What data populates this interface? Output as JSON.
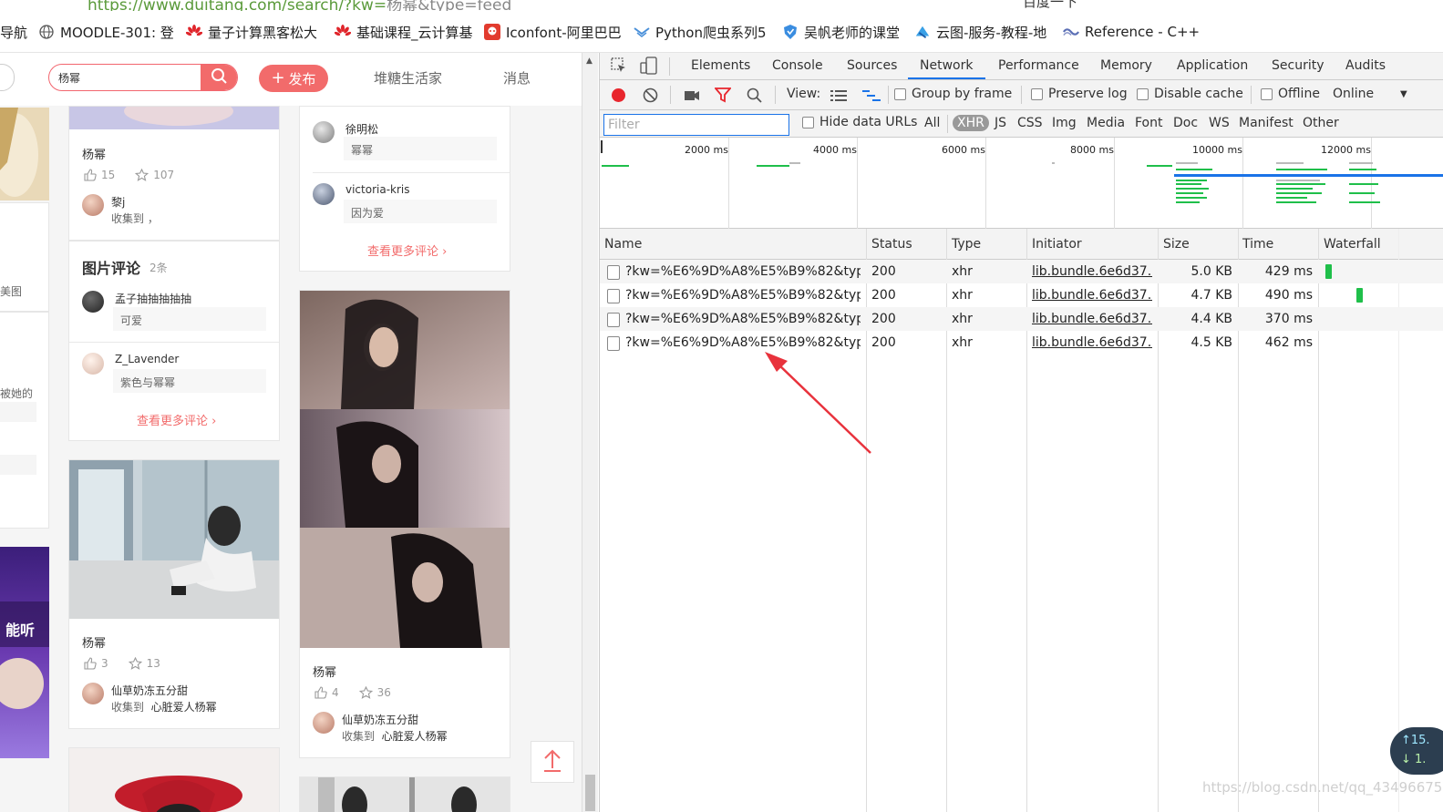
{
  "browser": {
    "url_partial": "https://www.duitang.com/search/?kw=",
    "url_rest": "杨幂&type=feed",
    "top_right_text": "百度一下",
    "bookmarks": [
      {
        "label": "导航",
        "icon": "none"
      },
      {
        "label": "MOODLE-301: 登",
        "icon": "globe-icon"
      },
      {
        "label": "量子计算黑客松大",
        "icon": "huawei-icon"
      },
      {
        "label": "基础课程_云计算基",
        "icon": "huawei-icon"
      },
      {
        "label": "Iconfont-阿里巴巴",
        "icon": "iconfont-icon"
      },
      {
        "label": "Python爬虫系列5",
        "icon": "bird-icon"
      },
      {
        "label": "吴帆老师的课堂",
        "icon": "shield-icon"
      },
      {
        "label": "云图-服务-教程-地",
        "icon": "cloud-icon"
      },
      {
        "label": "Reference - C++",
        "icon": "ref-icon"
      }
    ]
  },
  "webpage": {
    "search": {
      "value": "杨幂"
    },
    "publish_label": "发布",
    "nav": [
      "堆糖生活家",
      "消息"
    ],
    "left_col_text": [
      "美图",
      "被她的"
    ],
    "left_banner_text": "能听",
    "cards": {
      "c1": {
        "title": "杨幂",
        "likes": "15",
        "stars": "107",
        "user": "黎j",
        "action": "收集到 ，"
      },
      "comments_title": "图片评论",
      "comments_count": "2条",
      "comments": [
        {
          "user": "孟子抽抽抽抽抽",
          "text": "可爱"
        },
        {
          "user": "Z_Lavender",
          "text": "紫色与幂幂"
        }
      ],
      "more_comments": "查看更多评论",
      "c2": {
        "title": "杨幂",
        "likes": "3",
        "stars": "13",
        "user": "仙草奶冻五分甜",
        "action": "收集到",
        "album": "心脏爱人杨幂"
      },
      "right_comments": [
        {
          "user": "徐明松",
          "text": "幂幂"
        },
        {
          "user": "victoria-kris",
          "text": "因为爱"
        }
      ],
      "right_more": "查看更多评论",
      "c3": {
        "title": "杨幂",
        "likes": "4",
        "stars": "36",
        "user": "仙草奶冻五分甜",
        "action": "收集到",
        "album": "心脏爱人杨幂"
      }
    }
  },
  "devtools": {
    "tabs": [
      "Elements",
      "Console",
      "Sources",
      "Network",
      "Performance",
      "Memory",
      "Application",
      "Security",
      "Audits"
    ],
    "active_tab": "Network",
    "toolbar": {
      "view_label": "View:",
      "group_by_frame": "Group by frame",
      "preserve_log": "Preserve log",
      "disable_cache": "Disable cache",
      "offline": "Offline",
      "throttle": "Online"
    },
    "filter": {
      "placeholder": "Filter",
      "hide_data_urls": "Hide data URLs",
      "types": [
        "All",
        "XHR",
        "JS",
        "CSS",
        "Img",
        "Media",
        "Font",
        "Doc",
        "WS",
        "Manifest",
        "Other"
      ],
      "active_type": "XHR"
    },
    "overview_ticks": [
      "2000 ms",
      "4000 ms",
      "6000 ms",
      "8000 ms",
      "10000 ms",
      "12000 ms"
    ],
    "columns": [
      "Name",
      "Status",
      "Type",
      "Initiator",
      "Size",
      "Time",
      "Waterfall"
    ],
    "rows": [
      {
        "name": "?kw=%E6%9D%A8%E5%B9%82&typ...",
        "status": "200",
        "type": "xhr",
        "initiator": "lib.bundle.6e6d37...",
        "size": "5.0 KB",
        "time": "429 ms",
        "wf_offset": 0.05
      },
      {
        "name": "?kw=%E6%9D%A8%E5%B9%82&typ...",
        "status": "200",
        "type": "xhr",
        "initiator": "lib.bundle.6e6d37...",
        "size": "4.7 KB",
        "time": "490 ms",
        "wf_offset": 0.48
      },
      {
        "name": "?kw=%E6%9D%A8%E5%B9%82&typ...",
        "status": "200",
        "type": "xhr",
        "initiator": "lib.bundle.6e6d37...",
        "size": "4.4 KB",
        "time": "370 ms",
        "wf_offset": null
      },
      {
        "name": "?kw=%E6%9D%A8%E5%B9%82&typ...",
        "status": "200",
        "type": "xhr",
        "initiator": "lib.bundle.6e6d37...",
        "size": "4.5 KB",
        "time": "462 ms",
        "wf_offset": null
      }
    ]
  },
  "speed_widget": {
    "up": "↑15.",
    "down": "↓ 1."
  },
  "watermark": "https://blog.csdn.net/qq_43496675",
  "colors": {
    "accent": "#f26b6b",
    "devtools_blue": "#1a73e8",
    "waterfall_green": "#1fbf4a",
    "arrow_red": "#e8323c"
  }
}
